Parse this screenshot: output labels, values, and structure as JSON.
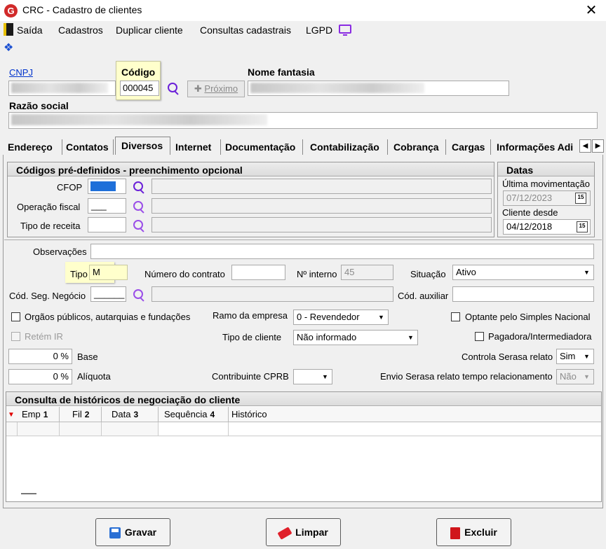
{
  "window": {
    "title": "CRC - Cadastro de clientes",
    "app_logo": "G",
    "close_glyph": "✕"
  },
  "menu": {
    "items": [
      "Saída",
      "Cadastros",
      "Duplicar cliente",
      "Consultas cadastrais",
      "LGPD"
    ]
  },
  "header": {
    "cnpj_label": "CNPJ",
    "codigo_label": "Código",
    "codigo_value": "000045",
    "proximo_label": "Próximo",
    "nome_fantasia_label": "Nome fantasia",
    "razao_social_label": "Razão social"
  },
  "tabs": [
    "Endereço",
    "Contatos",
    "Diversos",
    "Internet",
    "Documentação",
    "Contabilização",
    "Cobrança",
    "Cargas",
    "Informações Adi"
  ],
  "tab_arrows": {
    "left": "◀",
    "right": "▶"
  },
  "codigos": {
    "title": "Códigos pré-definidos - preenchimento opcional",
    "cfop_label": "CFOP",
    "operacao_label": "Operação fiscal",
    "operacao_value": "___",
    "receita_label": "Tipo de receita"
  },
  "datas": {
    "title": "Datas",
    "ultima_label": "Última movimentação",
    "ultima_value": "07/12/2023",
    "cliente_desde_label": "Cliente desde",
    "cliente_desde_value": "04/12/2018",
    "cal_glyph": "15"
  },
  "form": {
    "observacoes_label": "Observações",
    "tipo_label": "Tipo",
    "tipo_value": "M",
    "numero_contrato_label": "Número do contrato",
    "n_interno_label": "Nº interno",
    "n_interno_value": "45",
    "situacao_label": "Situação",
    "situacao_value": "Ativo",
    "cod_seg_label": "Cód. Seg. Negócio",
    "cod_seg_value": "______",
    "cod_aux_label": "Cód. auxiliar",
    "orgaos_label": "Orgãos públicos, autarquias e fundações",
    "ramo_label": "Ramo da empresa",
    "ramo_value": "0 - Revendedor",
    "simples_label": "Optante pelo Simples Nacional",
    "retem_label": "Retém IR",
    "tipo_cliente_label": "Tipo de cliente",
    "tipo_cliente_value": "Não informado",
    "pagadora_label": "Pagadora/Intermediadora",
    "base_value": "0 %",
    "base_label": "Base",
    "controla_label": "Controla Serasa relato",
    "controla_value": "Sim",
    "aliquota_value": "0 %",
    "aliquota_label": "Alíquota",
    "cprb_label": "Contribuinte CPRB",
    "envio_label": "Envio Serasa relato tempo relacionamento",
    "envio_value": "Não"
  },
  "historico": {
    "title": "Consulta de históricos de negociação do cliente",
    "columns": [
      {
        "label": "Emp",
        "num": "1"
      },
      {
        "label": "Fil",
        "num": "2"
      },
      {
        "label": "Data",
        "num": "3"
      },
      {
        "label": "Sequência",
        "num": "4"
      },
      {
        "label": "Histórico",
        "num": ""
      }
    ]
  },
  "buttons": {
    "gravar": "Gravar",
    "limpar": "Limpar",
    "excluir": "Excluir"
  },
  "colors": {
    "accent_purple": "#8a2be2",
    "tooltip_yellow": "#ffffcc",
    "cfop_fill": "#1e6fd9",
    "danger_red": "#d0161b"
  }
}
